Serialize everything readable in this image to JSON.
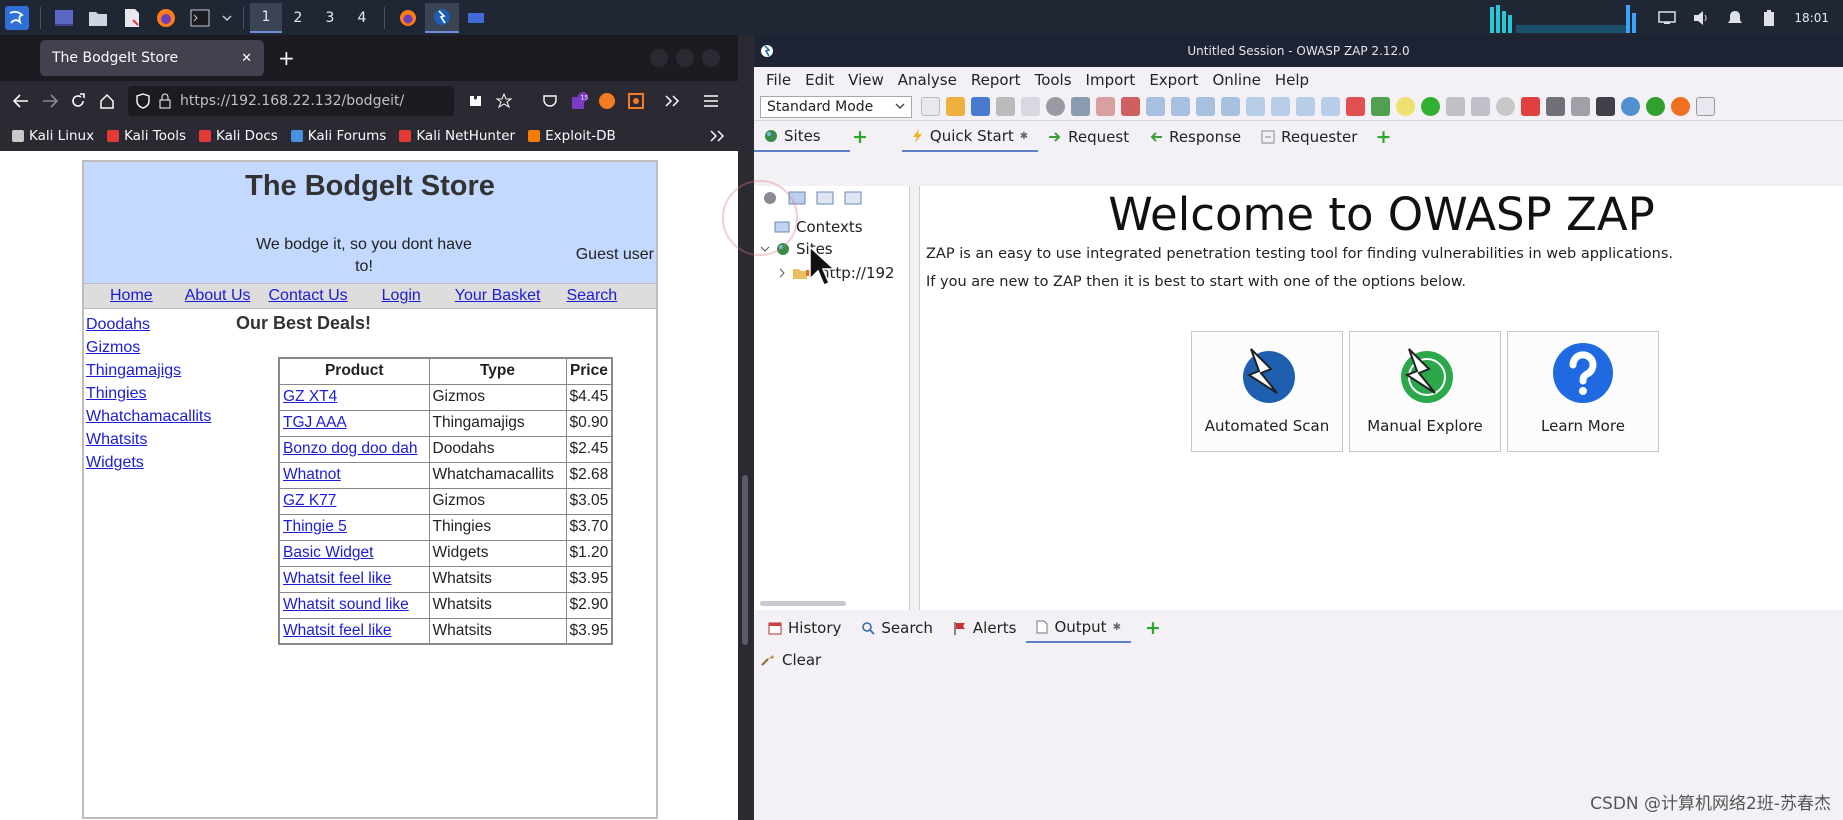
{
  "taskbar": {
    "workspaces": [
      "1",
      "2",
      "3",
      "4"
    ],
    "clock": "18:01"
  },
  "firefox": {
    "tab_title": "The BodgeIt Store",
    "url": "https://192.168.22.132/bodgeit/",
    "bookmarks": [
      {
        "label": "Kali Linux",
        "color": "#c8c8c8"
      },
      {
        "label": "Kali Tools",
        "color": "#e53935"
      },
      {
        "label": "Kali Docs",
        "color": "#e53935"
      },
      {
        "label": "Kali Forums",
        "color": "#4a90e2"
      },
      {
        "label": "Kali NetHunter",
        "color": "#e53935"
      },
      {
        "label": "Exploit-DB",
        "color": "#f57c00"
      }
    ]
  },
  "bodgeit": {
    "title": "The BodgeIt Store",
    "tagline": "We bodge it, so you dont have to!",
    "user": "Guest user",
    "menu": [
      "Home",
      "About Us",
      "Contact Us",
      "Login",
      "Your Basket",
      "Search"
    ],
    "categories": [
      "Doodahs",
      "Gizmos",
      "Thingamajigs",
      "Thingies",
      "Whatchamacallits",
      "Whatsits",
      "Widgets"
    ],
    "deals_heading": "Our Best Deals!",
    "table": {
      "headers": [
        "Product",
        "Type",
        "Price"
      ],
      "rows": [
        [
          "GZ XT4",
          "Gizmos",
          "$4.45"
        ],
        [
          "TGJ AAA",
          "Thingamajigs",
          "$0.90"
        ],
        [
          "Bonzo dog doo dah",
          "Doodahs",
          "$2.45"
        ],
        [
          "Whatnot",
          "Whatchamacallits",
          "$2.68"
        ],
        [
          "GZ K77",
          "Gizmos",
          "$3.05"
        ],
        [
          "Thingie 5",
          "Thingies",
          "$3.70"
        ],
        [
          "Basic Widget",
          "Widgets",
          "$1.20"
        ],
        [
          "Whatsit feel like",
          "Whatsits",
          "$3.95"
        ],
        [
          "Whatsit sound like",
          "Whatsits",
          "$2.90"
        ],
        [
          "Whatsit feel like",
          "Whatsits",
          "$3.95"
        ]
      ]
    }
  },
  "zap": {
    "window_title": "Untitled Session - OWASP ZAP 2.12.0",
    "menu": [
      "File",
      "Edit",
      "View",
      "Analyse",
      "Report",
      "Tools",
      "Import",
      "Export",
      "Online",
      "Help"
    ],
    "mode": "Standard Mode",
    "tabs_left": [
      {
        "label": "Sites"
      }
    ],
    "tabs_main": [
      {
        "label": "Quick Start",
        "active": true
      },
      {
        "label": "Request"
      },
      {
        "label": "Response"
      },
      {
        "label": "Requester"
      }
    ],
    "tree": {
      "contexts": "Contexts",
      "sites": "Sites",
      "site_node": "http://192"
    },
    "welcome": "Welcome to OWASP ZAP",
    "intro": "ZAP is an easy to use integrated penetration testing tool for finding vulnerabilities in web applications.",
    "intro2": "If you are new to ZAP then it is best to start with one of the options below.",
    "buttons": [
      "Automated Scan",
      "Manual Explore",
      "Learn More"
    ],
    "bottom_tabs": [
      {
        "label": "History"
      },
      {
        "label": "Search"
      },
      {
        "label": "Alerts"
      },
      {
        "label": "Output",
        "active": true
      }
    ],
    "clear_label": "Clear"
  },
  "watermark": "CSDN @计算机网络2班-苏春杰"
}
